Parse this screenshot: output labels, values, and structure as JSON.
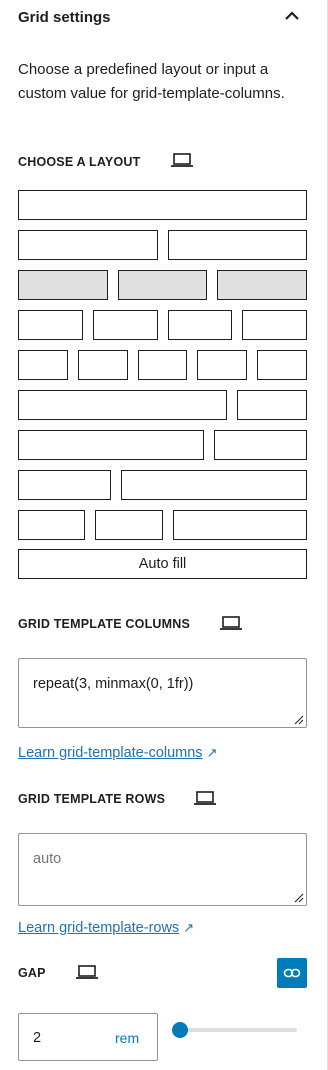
{
  "panel": {
    "title": "Grid settings",
    "description": "Choose a predefined layout or input a custom value for grid-template-columns."
  },
  "layout": {
    "label": "CHOOSE A LAYOUT",
    "auto_fill_label": "Auto fill",
    "selected_row": 3
  },
  "columns": {
    "label": "GRID TEMPLATE COLUMNS",
    "value": "repeat(3, minmax(0, 1fr))",
    "learn_link": "Learn grid-template-columns",
    "arrow": "↗"
  },
  "rows": {
    "label": "GRID TEMPLATE ROWS",
    "placeholder": "auto",
    "learn_link": "Learn grid-template-rows",
    "arrow": "↗"
  },
  "gap": {
    "label": "GAP",
    "value": "2",
    "unit": "rem",
    "slider_fraction": 0.0
  },
  "colors": {
    "accent": "#007cba",
    "link": "#2271b1",
    "selected_fill": "#e0e0e0"
  },
  "icons": {
    "collapse": "chevron-up-icon",
    "device": "laptop-icon",
    "link": "link-icon",
    "external": "external-arrow-icon"
  }
}
